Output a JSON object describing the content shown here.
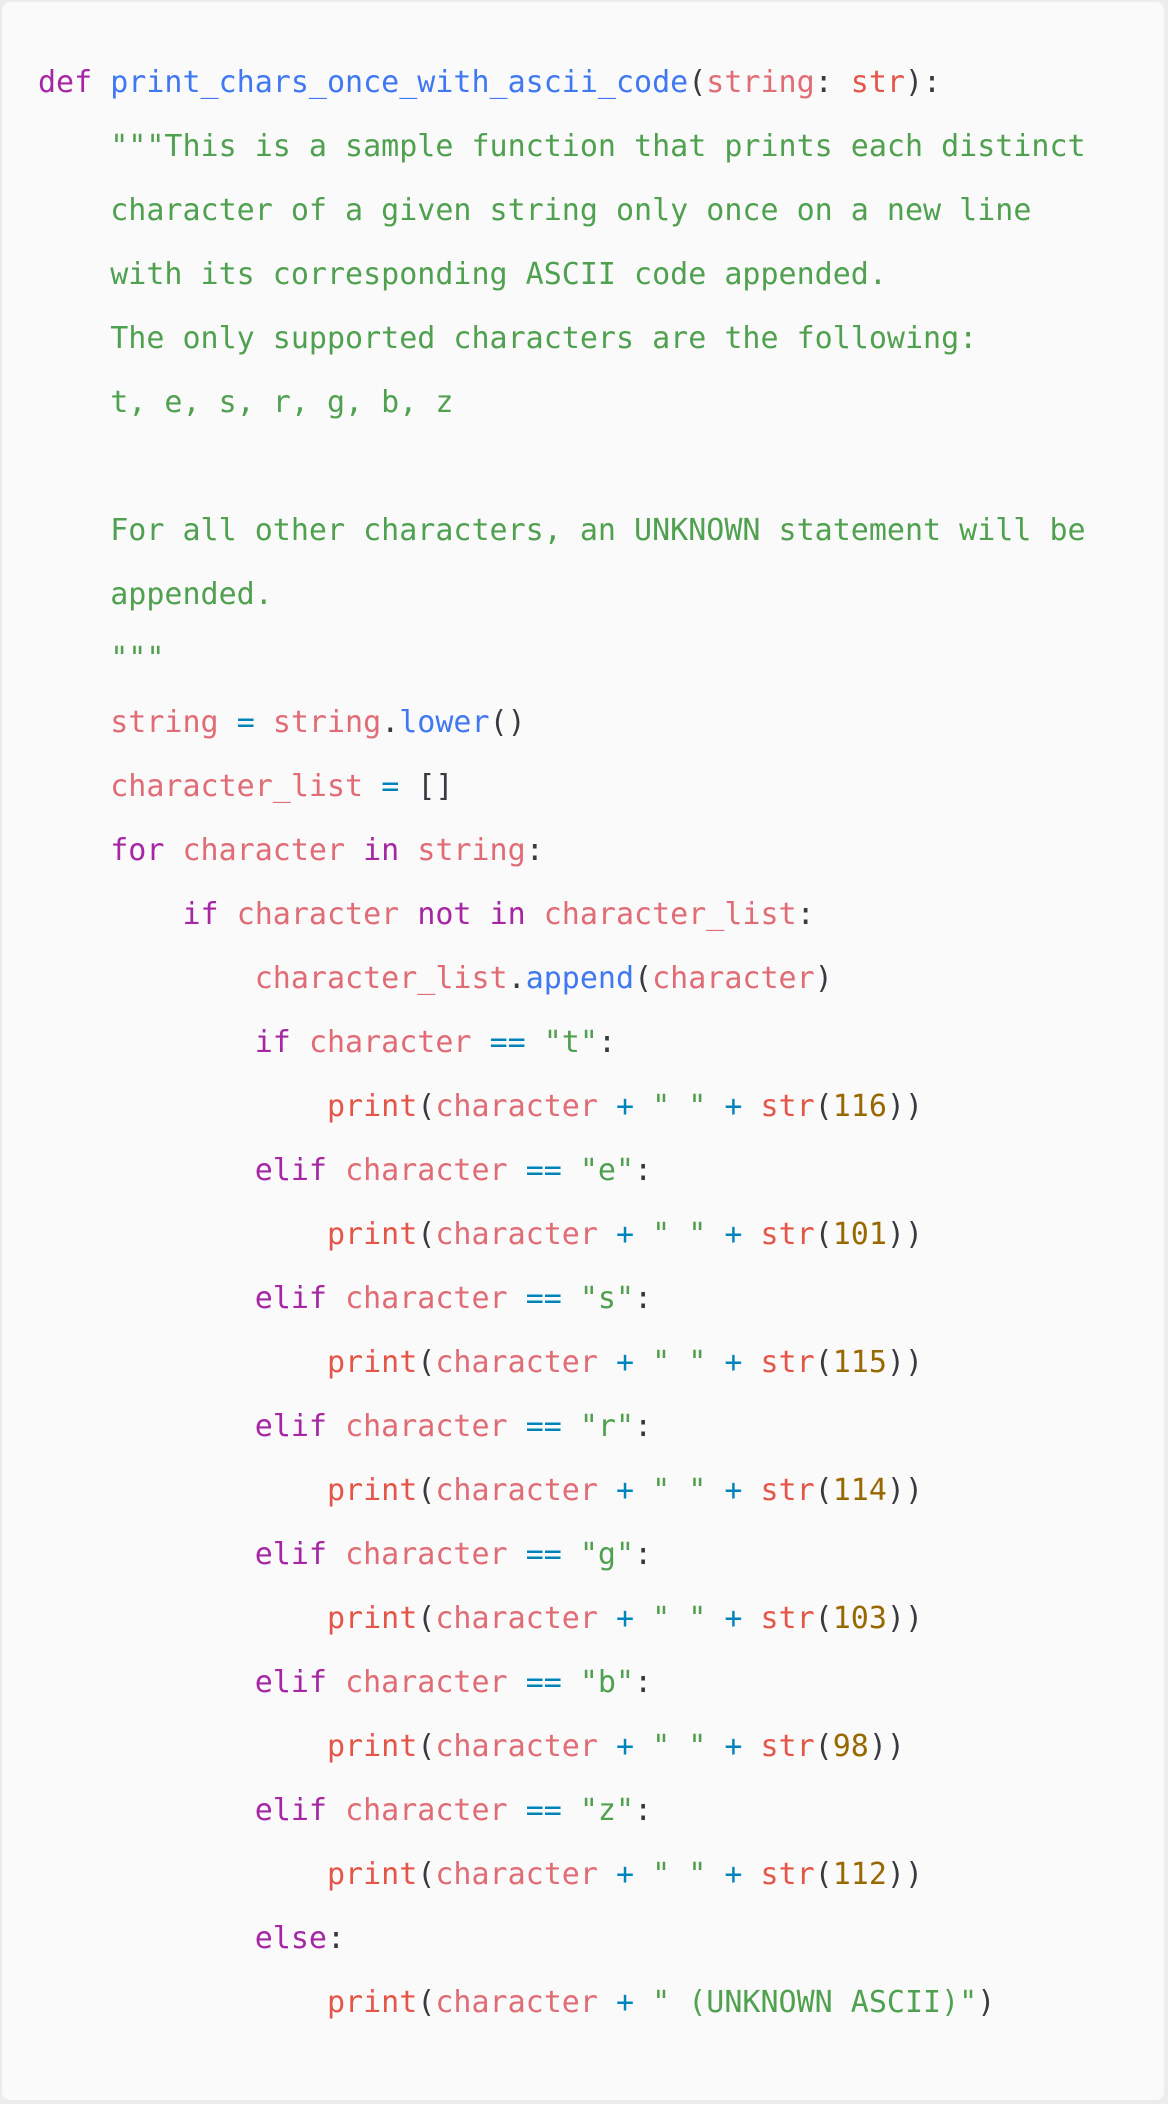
{
  "code": {
    "language": "python",
    "colors": {
      "background": "#fafafa",
      "keyword": "#a626a4",
      "function": "#4078f2",
      "variable": "#e06c75",
      "builtin": "#e45649",
      "string": "#50a14f",
      "operator": "#0184bc",
      "number": "#986801",
      "punctuation": "#383a42"
    },
    "lines": [
      {
        "indent": 0,
        "tokens": [
          {
            "t": "keyword",
            "v": "def"
          },
          {
            "t": "plain",
            "v": " "
          },
          {
            "t": "funcname",
            "v": "print_chars_once_with_ascii_code"
          },
          {
            "t": "punct",
            "v": "("
          },
          {
            "t": "param",
            "v": "string"
          },
          {
            "t": "punct",
            "v": ": "
          },
          {
            "t": "builtin",
            "v": "str"
          },
          {
            "t": "punct",
            "v": "):"
          }
        ]
      },
      {
        "indent": 1,
        "tokens": [
          {
            "t": "docstring",
            "v": "\"\"\"This is a sample function that prints each distinct"
          }
        ]
      },
      {
        "indent": 1,
        "tokens": [
          {
            "t": "docstring",
            "v": "character of a given string only once on a new line"
          }
        ]
      },
      {
        "indent": 1,
        "tokens": [
          {
            "t": "docstring",
            "v": "with its corresponding ASCII code appended."
          }
        ]
      },
      {
        "indent": 1,
        "tokens": [
          {
            "t": "docstring",
            "v": "The only supported characters are the following:"
          }
        ]
      },
      {
        "indent": 1,
        "tokens": [
          {
            "t": "docstring",
            "v": "t, e, s, r, g, b, z"
          }
        ]
      },
      {
        "indent": 0,
        "tokens": []
      },
      {
        "indent": 1,
        "tokens": [
          {
            "t": "docstring",
            "v": "For all other characters, an UNKNOWN statement will be"
          }
        ]
      },
      {
        "indent": 1,
        "tokens": [
          {
            "t": "docstring",
            "v": "appended."
          }
        ]
      },
      {
        "indent": 1,
        "tokens": [
          {
            "t": "docstring",
            "v": "\"\"\""
          }
        ]
      },
      {
        "indent": 1,
        "tokens": [
          {
            "t": "var",
            "v": "string"
          },
          {
            "t": "plain",
            "v": " "
          },
          {
            "t": "operator",
            "v": "="
          },
          {
            "t": "plain",
            "v": " "
          },
          {
            "t": "var",
            "v": "string"
          },
          {
            "t": "punct",
            "v": "."
          },
          {
            "t": "method",
            "v": "lower"
          },
          {
            "t": "punct",
            "v": "()"
          }
        ]
      },
      {
        "indent": 1,
        "tokens": [
          {
            "t": "var",
            "v": "character_list"
          },
          {
            "t": "plain",
            "v": " "
          },
          {
            "t": "operator",
            "v": "="
          },
          {
            "t": "plain",
            "v": " "
          },
          {
            "t": "punct",
            "v": "[]"
          }
        ]
      },
      {
        "indent": 1,
        "tokens": [
          {
            "t": "keyword",
            "v": "for"
          },
          {
            "t": "plain",
            "v": " "
          },
          {
            "t": "var",
            "v": "character"
          },
          {
            "t": "plain",
            "v": " "
          },
          {
            "t": "keyword",
            "v": "in"
          },
          {
            "t": "plain",
            "v": " "
          },
          {
            "t": "var",
            "v": "string"
          },
          {
            "t": "punct",
            "v": ":"
          }
        ]
      },
      {
        "indent": 2,
        "tokens": [
          {
            "t": "keyword",
            "v": "if"
          },
          {
            "t": "plain",
            "v": " "
          },
          {
            "t": "var",
            "v": "character"
          },
          {
            "t": "plain",
            "v": " "
          },
          {
            "t": "keyword",
            "v": "not"
          },
          {
            "t": "plain",
            "v": " "
          },
          {
            "t": "keyword",
            "v": "in"
          },
          {
            "t": "plain",
            "v": " "
          },
          {
            "t": "var",
            "v": "character_list"
          },
          {
            "t": "punct",
            "v": ":"
          }
        ]
      },
      {
        "indent": 3,
        "tokens": [
          {
            "t": "var",
            "v": "character_list"
          },
          {
            "t": "punct",
            "v": "."
          },
          {
            "t": "method",
            "v": "append"
          },
          {
            "t": "punct",
            "v": "("
          },
          {
            "t": "var",
            "v": "character"
          },
          {
            "t": "punct",
            "v": ")"
          }
        ]
      },
      {
        "indent": 3,
        "tokens": [
          {
            "t": "keyword",
            "v": "if"
          },
          {
            "t": "plain",
            "v": " "
          },
          {
            "t": "var",
            "v": "character"
          },
          {
            "t": "plain",
            "v": " "
          },
          {
            "t": "operator",
            "v": "=="
          },
          {
            "t": "plain",
            "v": " "
          },
          {
            "t": "string",
            "v": "\"t\""
          },
          {
            "t": "punct",
            "v": ":"
          }
        ]
      },
      {
        "indent": 4,
        "tokens": [
          {
            "t": "builtin",
            "v": "print"
          },
          {
            "t": "punct",
            "v": "("
          },
          {
            "t": "var",
            "v": "character"
          },
          {
            "t": "plain",
            "v": " "
          },
          {
            "t": "operator",
            "v": "+"
          },
          {
            "t": "plain",
            "v": " "
          },
          {
            "t": "string",
            "v": "\" \""
          },
          {
            "t": "plain",
            "v": " "
          },
          {
            "t": "operator",
            "v": "+"
          },
          {
            "t": "plain",
            "v": " "
          },
          {
            "t": "builtin",
            "v": "str"
          },
          {
            "t": "punct",
            "v": "("
          },
          {
            "t": "number",
            "v": "116"
          },
          {
            "t": "punct",
            "v": "))"
          }
        ]
      },
      {
        "indent": 3,
        "tokens": [
          {
            "t": "keyword",
            "v": "elif"
          },
          {
            "t": "plain",
            "v": " "
          },
          {
            "t": "var",
            "v": "character"
          },
          {
            "t": "plain",
            "v": " "
          },
          {
            "t": "operator",
            "v": "=="
          },
          {
            "t": "plain",
            "v": " "
          },
          {
            "t": "string",
            "v": "\"e\""
          },
          {
            "t": "punct",
            "v": ":"
          }
        ]
      },
      {
        "indent": 4,
        "tokens": [
          {
            "t": "builtin",
            "v": "print"
          },
          {
            "t": "punct",
            "v": "("
          },
          {
            "t": "var",
            "v": "character"
          },
          {
            "t": "plain",
            "v": " "
          },
          {
            "t": "operator",
            "v": "+"
          },
          {
            "t": "plain",
            "v": " "
          },
          {
            "t": "string",
            "v": "\" \""
          },
          {
            "t": "plain",
            "v": " "
          },
          {
            "t": "operator",
            "v": "+"
          },
          {
            "t": "plain",
            "v": " "
          },
          {
            "t": "builtin",
            "v": "str"
          },
          {
            "t": "punct",
            "v": "("
          },
          {
            "t": "number",
            "v": "101"
          },
          {
            "t": "punct",
            "v": "))"
          }
        ]
      },
      {
        "indent": 3,
        "tokens": [
          {
            "t": "keyword",
            "v": "elif"
          },
          {
            "t": "plain",
            "v": " "
          },
          {
            "t": "var",
            "v": "character"
          },
          {
            "t": "plain",
            "v": " "
          },
          {
            "t": "operator",
            "v": "=="
          },
          {
            "t": "plain",
            "v": " "
          },
          {
            "t": "string",
            "v": "\"s\""
          },
          {
            "t": "punct",
            "v": ":"
          }
        ]
      },
      {
        "indent": 4,
        "tokens": [
          {
            "t": "builtin",
            "v": "print"
          },
          {
            "t": "punct",
            "v": "("
          },
          {
            "t": "var",
            "v": "character"
          },
          {
            "t": "plain",
            "v": " "
          },
          {
            "t": "operator",
            "v": "+"
          },
          {
            "t": "plain",
            "v": " "
          },
          {
            "t": "string",
            "v": "\" \""
          },
          {
            "t": "plain",
            "v": " "
          },
          {
            "t": "operator",
            "v": "+"
          },
          {
            "t": "plain",
            "v": " "
          },
          {
            "t": "builtin",
            "v": "str"
          },
          {
            "t": "punct",
            "v": "("
          },
          {
            "t": "number",
            "v": "115"
          },
          {
            "t": "punct",
            "v": "))"
          }
        ]
      },
      {
        "indent": 3,
        "tokens": [
          {
            "t": "keyword",
            "v": "elif"
          },
          {
            "t": "plain",
            "v": " "
          },
          {
            "t": "var",
            "v": "character"
          },
          {
            "t": "plain",
            "v": " "
          },
          {
            "t": "operator",
            "v": "=="
          },
          {
            "t": "plain",
            "v": " "
          },
          {
            "t": "string",
            "v": "\"r\""
          },
          {
            "t": "punct",
            "v": ":"
          }
        ]
      },
      {
        "indent": 4,
        "tokens": [
          {
            "t": "builtin",
            "v": "print"
          },
          {
            "t": "punct",
            "v": "("
          },
          {
            "t": "var",
            "v": "character"
          },
          {
            "t": "plain",
            "v": " "
          },
          {
            "t": "operator",
            "v": "+"
          },
          {
            "t": "plain",
            "v": " "
          },
          {
            "t": "string",
            "v": "\" \""
          },
          {
            "t": "plain",
            "v": " "
          },
          {
            "t": "operator",
            "v": "+"
          },
          {
            "t": "plain",
            "v": " "
          },
          {
            "t": "builtin",
            "v": "str"
          },
          {
            "t": "punct",
            "v": "("
          },
          {
            "t": "number",
            "v": "114"
          },
          {
            "t": "punct",
            "v": "))"
          }
        ]
      },
      {
        "indent": 3,
        "tokens": [
          {
            "t": "keyword",
            "v": "elif"
          },
          {
            "t": "plain",
            "v": " "
          },
          {
            "t": "var",
            "v": "character"
          },
          {
            "t": "plain",
            "v": " "
          },
          {
            "t": "operator",
            "v": "=="
          },
          {
            "t": "plain",
            "v": " "
          },
          {
            "t": "string",
            "v": "\"g\""
          },
          {
            "t": "punct",
            "v": ":"
          }
        ]
      },
      {
        "indent": 4,
        "tokens": [
          {
            "t": "builtin",
            "v": "print"
          },
          {
            "t": "punct",
            "v": "("
          },
          {
            "t": "var",
            "v": "character"
          },
          {
            "t": "plain",
            "v": " "
          },
          {
            "t": "operator",
            "v": "+"
          },
          {
            "t": "plain",
            "v": " "
          },
          {
            "t": "string",
            "v": "\" \""
          },
          {
            "t": "plain",
            "v": " "
          },
          {
            "t": "operator",
            "v": "+"
          },
          {
            "t": "plain",
            "v": " "
          },
          {
            "t": "builtin",
            "v": "str"
          },
          {
            "t": "punct",
            "v": "("
          },
          {
            "t": "number",
            "v": "103"
          },
          {
            "t": "punct",
            "v": "))"
          }
        ]
      },
      {
        "indent": 3,
        "tokens": [
          {
            "t": "keyword",
            "v": "elif"
          },
          {
            "t": "plain",
            "v": " "
          },
          {
            "t": "var",
            "v": "character"
          },
          {
            "t": "plain",
            "v": " "
          },
          {
            "t": "operator",
            "v": "=="
          },
          {
            "t": "plain",
            "v": " "
          },
          {
            "t": "string",
            "v": "\"b\""
          },
          {
            "t": "punct",
            "v": ":"
          }
        ]
      },
      {
        "indent": 4,
        "tokens": [
          {
            "t": "builtin",
            "v": "print"
          },
          {
            "t": "punct",
            "v": "("
          },
          {
            "t": "var",
            "v": "character"
          },
          {
            "t": "plain",
            "v": " "
          },
          {
            "t": "operator",
            "v": "+"
          },
          {
            "t": "plain",
            "v": " "
          },
          {
            "t": "string",
            "v": "\" \""
          },
          {
            "t": "plain",
            "v": " "
          },
          {
            "t": "operator",
            "v": "+"
          },
          {
            "t": "plain",
            "v": " "
          },
          {
            "t": "builtin",
            "v": "str"
          },
          {
            "t": "punct",
            "v": "("
          },
          {
            "t": "number",
            "v": "98"
          },
          {
            "t": "punct",
            "v": "))"
          }
        ]
      },
      {
        "indent": 3,
        "tokens": [
          {
            "t": "keyword",
            "v": "elif"
          },
          {
            "t": "plain",
            "v": " "
          },
          {
            "t": "var",
            "v": "character"
          },
          {
            "t": "plain",
            "v": " "
          },
          {
            "t": "operator",
            "v": "=="
          },
          {
            "t": "plain",
            "v": " "
          },
          {
            "t": "string",
            "v": "\"z\""
          },
          {
            "t": "punct",
            "v": ":"
          }
        ]
      },
      {
        "indent": 4,
        "tokens": [
          {
            "t": "builtin",
            "v": "print"
          },
          {
            "t": "punct",
            "v": "("
          },
          {
            "t": "var",
            "v": "character"
          },
          {
            "t": "plain",
            "v": " "
          },
          {
            "t": "operator",
            "v": "+"
          },
          {
            "t": "plain",
            "v": " "
          },
          {
            "t": "string",
            "v": "\" \""
          },
          {
            "t": "plain",
            "v": " "
          },
          {
            "t": "operator",
            "v": "+"
          },
          {
            "t": "plain",
            "v": " "
          },
          {
            "t": "builtin",
            "v": "str"
          },
          {
            "t": "punct",
            "v": "("
          },
          {
            "t": "number",
            "v": "112"
          },
          {
            "t": "punct",
            "v": "))"
          }
        ]
      },
      {
        "indent": 3,
        "tokens": [
          {
            "t": "keyword",
            "v": "else"
          },
          {
            "t": "punct",
            "v": ":"
          }
        ]
      },
      {
        "indent": 4,
        "tokens": [
          {
            "t": "builtin",
            "v": "print"
          },
          {
            "t": "punct",
            "v": "("
          },
          {
            "t": "var",
            "v": "character"
          },
          {
            "t": "plain",
            "v": " "
          },
          {
            "t": "operator",
            "v": "+"
          },
          {
            "t": "plain",
            "v": " "
          },
          {
            "t": "string",
            "v": "\" (UNKNOWN ASCII)\""
          },
          {
            "t": "punct",
            "v": ")"
          }
        ]
      }
    ]
  }
}
